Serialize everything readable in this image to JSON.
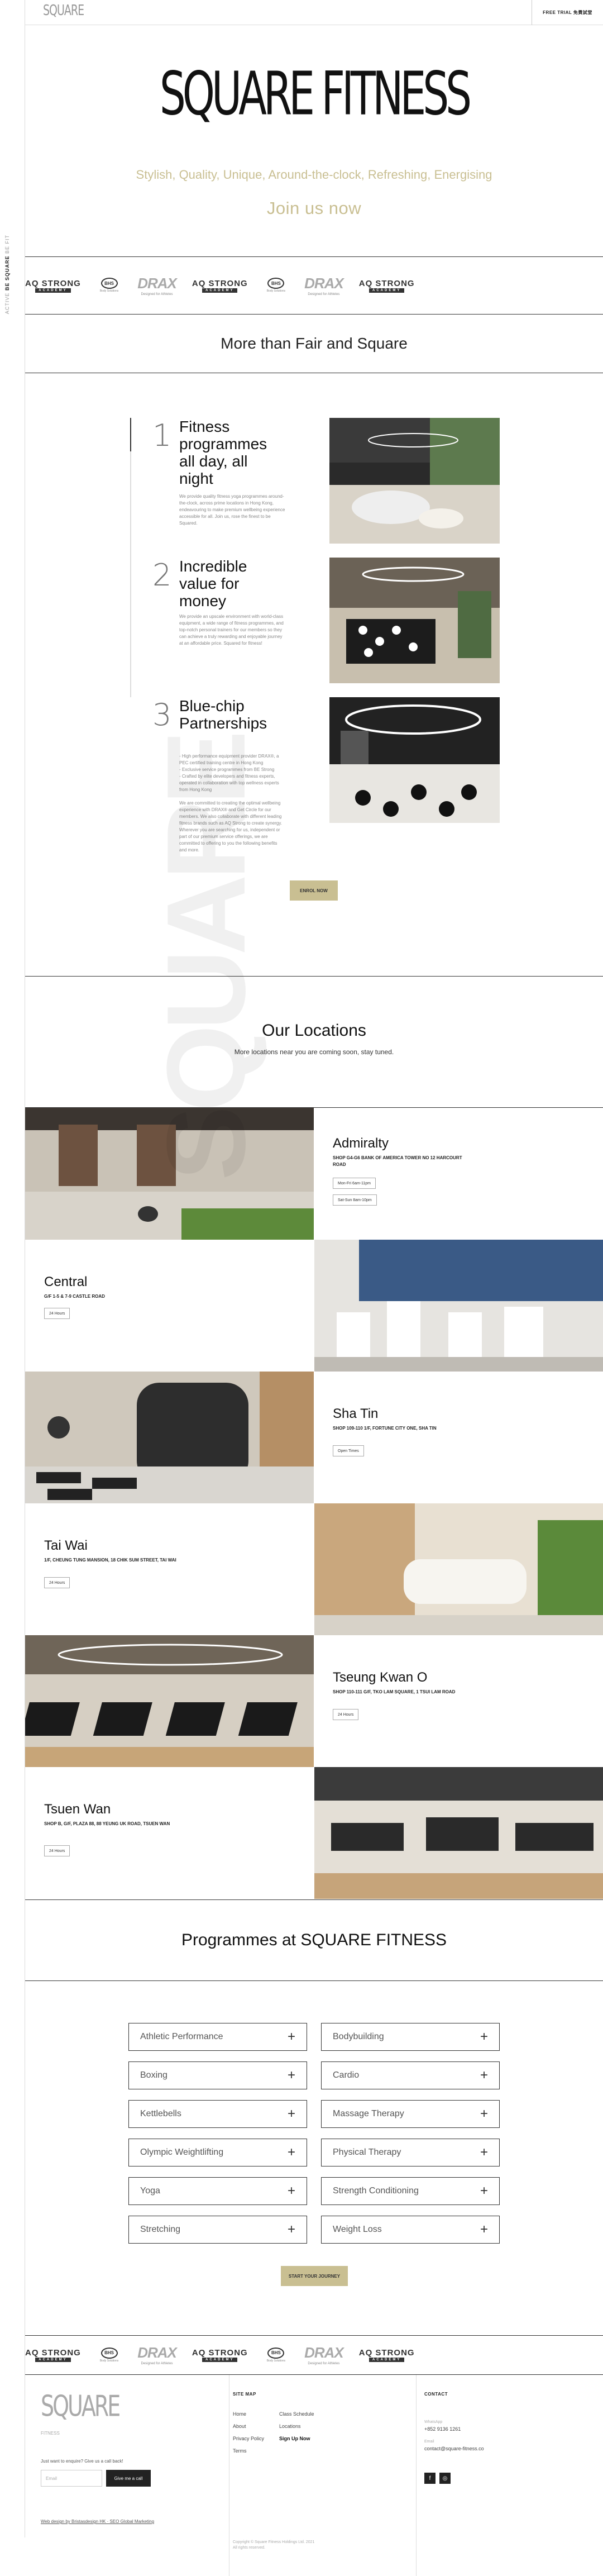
{
  "rail": {
    "tag_light": "ACTIVE",
    "tag_bold": "BE SQUARE",
    "tag_tail": "BE FIT"
  },
  "header": {
    "logo": "SQUARE",
    "trial_button": "FREE TRIAL 免費試堂"
  },
  "hero": {
    "title": "SQUARE FITNESS",
    "tagline": "Stylish, Quality, Unique, Around-the-clock, Refreshing, Energising",
    "join": "Join us now"
  },
  "brands": [
    {
      "type": "strong",
      "top": "AQ STRONG",
      "bottom": "ACADEMY"
    },
    {
      "type": "circ",
      "top": "BHS",
      "bottom": "Body Solutions"
    },
    {
      "type": "drax",
      "top": "DRAX",
      "bottom": "Designed for Athletes"
    },
    {
      "type": "strong",
      "top": "AQ STRONG",
      "bottom": "ACADEMY"
    },
    {
      "type": "circ",
      "top": "BHS",
      "bottom": "Body Solutions"
    },
    {
      "type": "drax",
      "top": "DRAX",
      "bottom": "Designed for Athletes"
    },
    {
      "type": "strong",
      "top": "AQ STRONG",
      "bottom": "ACADEMY"
    }
  ],
  "features_title": "More than Fair and Square",
  "features": [
    {
      "num": "1",
      "title": "Fitness programmes all day, all night",
      "body": "We provide quality fitness yoga programmes around-the-clock, across prime locations in Hong Kong, endeavouring to make premium wellbeing experience accessible for all. Join us, rose the finest to be Squared."
    },
    {
      "num": "2",
      "title": "Incredible value for money",
      "body": "We provide an upscale environment with world-class equipment, a wide range of fitness programmes, and top-notch personal trainers for our members so they can achieve a truly rewarding and enjoyable journey at an affordable price. Squared for fitness!"
    },
    {
      "num": "3",
      "title": "Blue-chip Partnerships",
      "body": "- High performance equipment provider DRAX®, a PEC certified training centre in Hong Kong\n- Exclusive service programmes from BE Strong\n- Crafted by elite developers and fitness experts, operated in collaboration with top wellness experts from Hong Kong\n\nWe are committed to creating the optimal wellbeing experience with DRAX® and Get Circle for our members. We also collaborate with different leading fitness brands such as AQ Strong to create synergy. Wherever you are searching for us, independent or part of our premium service offerings, we are committed to offering to you the following benefits and more."
    }
  ],
  "enquire_button": "ENROL NOW",
  "locations": {
    "title": "Our Locations",
    "subtitle": "More locations near you are coming soon, stay tuned.",
    "items": [
      {
        "name": "Admiralty",
        "addr": "SHOP G4-G6 BANK OF AMERICA TOWER NO 12 HARCOURT ROAD",
        "buttons": [
          "Mon-Fri 6am-11pm",
          "Sat-Sun 8am-10pm"
        ]
      },
      {
        "name": "Central",
        "addr": "G/F 1-5 & 7-9 CASTLE ROAD",
        "buttons": [
          "24 Hours"
        ]
      },
      {
        "name": "Sha Tin",
        "addr": "SHOP 109-110 1/F, FORTUNE CITY ONE, SHA TIN",
        "buttons": [
          "Open Times"
        ]
      },
      {
        "name": "Tai Wai",
        "addr": "1/F, CHEUNG TUNG MANSION, 18 CHIK SUM STREET, TAI WAI",
        "buttons": [
          "24 Hours"
        ]
      },
      {
        "name": "Tseung Kwan O",
        "addr": "SHOP 110-111 G/F, TKO LAM SQUARE, 1 TSUI LAM ROAD",
        "buttons": [
          "24 Hours"
        ]
      },
      {
        "name": "Tsuen Wan",
        "addr": "SHOP B, G/F, PLAZA 88, 88 YEUNG UK ROAD, TSUEN WAN",
        "buttons": [
          "24 Hours"
        ]
      }
    ]
  },
  "watermark": "SQUARE",
  "programmes": {
    "title": "Programmes at SQUARE FITNESS",
    "items": [
      "Athletic Performance",
      "Bodybuilding",
      "Boxing",
      "Cardio",
      "Kettlebells",
      "Massage Therapy",
      "Olympic Weightlifting",
      "Physical Therapy",
      "Yoga",
      "Strength Conditioning",
      "Stretching",
      "Weight Loss"
    ],
    "start_button": "START YOUR JOURNEY"
  },
  "footer": {
    "logo": "SQUARE",
    "logo_sub": "FITNESS",
    "hint": "Just want to enquire? Give us a call back!",
    "email_placeholder": "Email",
    "call_button": "Give me a call",
    "credit": "Web design by Bristasdesign HK · SEO Global Marketing",
    "sitemap_title": "SITE MAP",
    "links_col1": [
      "Home",
      "About",
      "Privacy Policy",
      "Terms"
    ],
    "links_col2": [
      "Class Schedule",
      "Locations",
      "Sign Up Now"
    ],
    "copyright": "Copyright © Square Fitness Holdings Ltd. 2021\nAll rights reserved.",
    "contact_title": "CONTACT",
    "contact_label": "WhatsApp",
    "phone": "+852 9136 1261",
    "email_label": "Email",
    "email": "contact@square-fitness.co"
  }
}
